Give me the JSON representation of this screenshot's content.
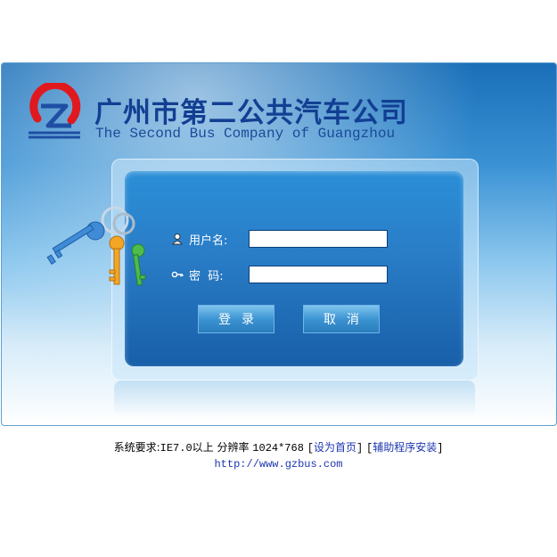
{
  "brand": {
    "name_cn": "广州市第二公共汽车公司",
    "name_en": "The Second Bus Company of Guangzhou",
    "logo_icon": "company-logo-icon",
    "colors": {
      "primary": "#123f93",
      "logo_red": "#e0191f",
      "logo_blue": "#1f4fa4"
    }
  },
  "login": {
    "username_label": "用户名:",
    "username_value": "",
    "username_icon": "user-icon",
    "password_label": "密  码:",
    "password_value": "",
    "password_icon": "key-icon",
    "login_button": "登录",
    "cancel_button": "取消",
    "decoration_icon": "keys-icon"
  },
  "footer": {
    "requirements_prefix": "系统要求:",
    "requirements_ie": "IE7.0",
    "requirements_mid": "以上 分辨率 ",
    "requirements_res": "1024*768",
    "link_homepage": "设为首页",
    "link_install": "辅助程序安装",
    "website": "http://www.gzbus.com"
  }
}
